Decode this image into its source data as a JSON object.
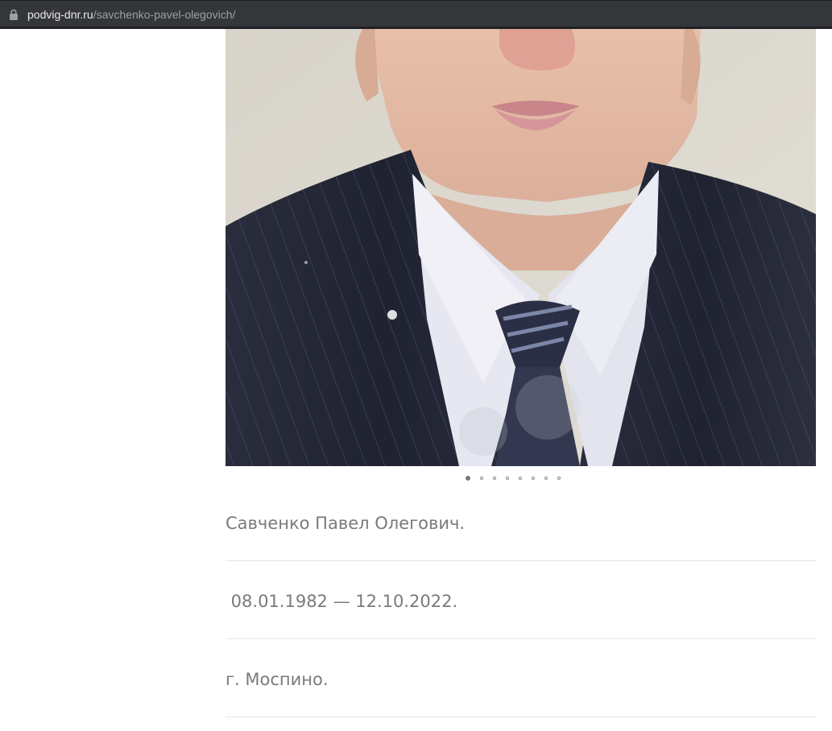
{
  "browser": {
    "url_domain": "podvig-dnr.ru",
    "url_path": "/savchenko-pavel-olegovich/"
  },
  "gallery": {
    "image_icon": "portrait-photo",
    "slide_count": 8,
    "active_slide": 1
  },
  "person": {
    "name": "Савченко Павел Олегович.",
    "dates": " 08.01.1982 — 12.10.2022.",
    "place": "г. Моспино."
  },
  "colors": {
    "text": "#7a7a7a",
    "divider": "#e6e6e6",
    "browser_bar": "#35363a"
  }
}
